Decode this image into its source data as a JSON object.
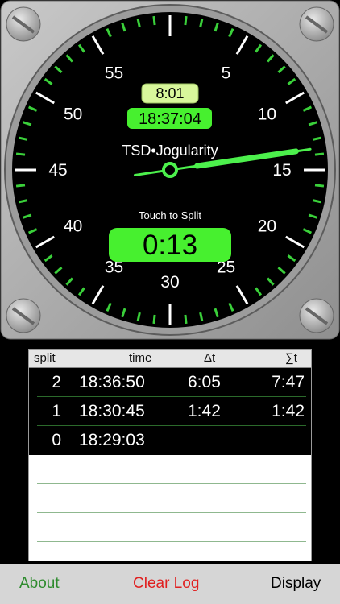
{
  "colors": {
    "bezel": "#b3b3b3",
    "dial": "#000000",
    "accent_green": "#4cf04c",
    "time_box_green": "#47f02f",
    "clock_box_green": "#d8f79b",
    "about": "#2e8b2e",
    "clear_log": "#e02020",
    "display": "#000000"
  },
  "dial": {
    "numerals": [
      "30",
      "35",
      "40",
      "45",
      "50",
      "55",
      "5",
      "10",
      "15",
      "20",
      "25"
    ],
    "brand": "TSD•Jogularity",
    "small_time": "8:01",
    "clock_time": "18:37:04",
    "touch_hint": "Touch to Split",
    "elapsed": "0:13",
    "hand_second_value": 13.6
  },
  "log": {
    "headers": {
      "split": "split",
      "time": "time",
      "dt": "Δt",
      "sum": "∑t"
    },
    "rows": [
      {
        "split": "2",
        "time": "18:36:50",
        "dt": "6:05",
        "sum": "7:47"
      },
      {
        "split": "1",
        "time": "18:30:45",
        "dt": "1:42",
        "sum": "1:42"
      },
      {
        "split": "0",
        "time": "18:29:03",
        "dt": "",
        "sum": ""
      }
    ]
  },
  "toolbar": {
    "about": "About",
    "clear_log": "Clear Log",
    "display": "Display"
  }
}
